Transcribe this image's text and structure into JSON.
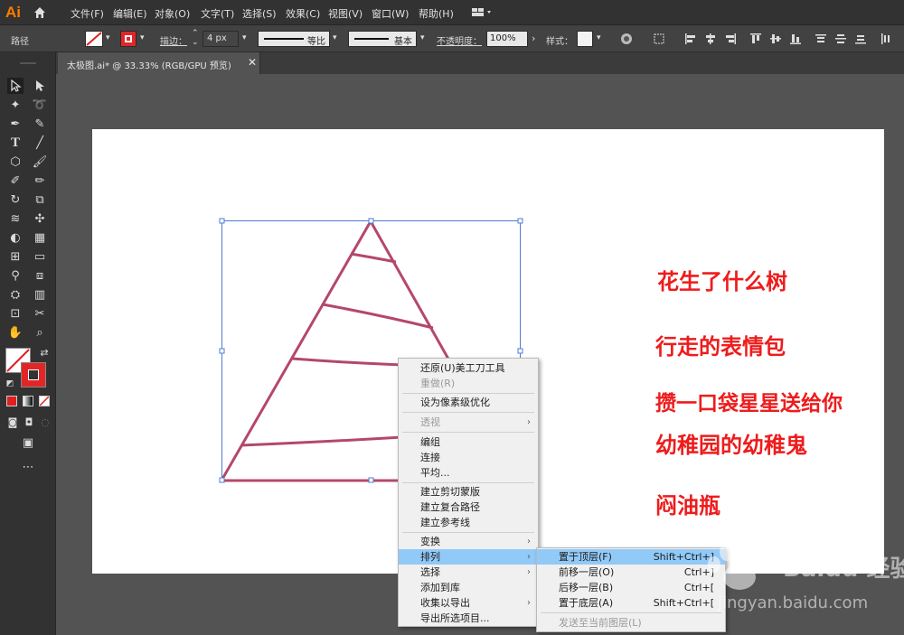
{
  "app": {
    "logo": "Ai",
    "menu": [
      "文件(F)",
      "编辑(E)",
      "对象(O)",
      "文字(T)",
      "选择(S)",
      "效果(C)",
      "视图(V)",
      "窗口(W)",
      "帮助(H)"
    ]
  },
  "control": {
    "selection_label": "路径",
    "stroke_label": "描边：",
    "stroke_weight": "4 px",
    "profile_label": "等比",
    "brush_label": "基本",
    "opacity_label": "不透明度：",
    "opacity_value": "100%",
    "style_label": "样式："
  },
  "document": {
    "tab_title": "太极图.ai* @ 33.33% (RGB/GPU 预览)",
    "close_glyph": "✕"
  },
  "colors": {
    "accent": "#ff7c00",
    "stroke_path": "#b5476b",
    "note_text": "#ee1c1c",
    "menu_highlight": "#91c9f7",
    "selection": "#4c7bd6"
  },
  "notes": [
    "花生了什么树",
    "行走的表情包",
    "攒一口袋星星送给你",
    "幼稚园的幼稚鬼",
    "闷油瓶"
  ],
  "context_menu": {
    "items": [
      {
        "label": "还原(U)美工刀工具",
        "disabled": false,
        "submenu": false
      },
      {
        "label": "重做(R)",
        "disabled": true,
        "submenu": false
      },
      {
        "label": "设为像素级优化",
        "disabled": false,
        "submenu": false
      },
      {
        "label": "透视",
        "disabled": true,
        "submenu": true
      },
      {
        "label": "编组",
        "disabled": false,
        "submenu": false
      },
      {
        "label": "连接",
        "disabled": false,
        "submenu": false
      },
      {
        "label": "平均...",
        "disabled": false,
        "submenu": false
      },
      {
        "label": "建立剪切蒙版",
        "disabled": false,
        "submenu": false
      },
      {
        "label": "建立复合路径",
        "disabled": false,
        "submenu": false
      },
      {
        "label": "建立参考线",
        "disabled": false,
        "submenu": false
      },
      {
        "label": "变换",
        "disabled": false,
        "submenu": true
      },
      {
        "label": "排列",
        "disabled": false,
        "submenu": true,
        "active": true
      },
      {
        "label": "选择",
        "disabled": false,
        "submenu": true
      },
      {
        "label": "添加到库",
        "disabled": false,
        "submenu": false
      },
      {
        "label": "收集以导出",
        "disabled": false,
        "submenu": true
      },
      {
        "label": "导出所选项目...",
        "disabled": false,
        "submenu": false
      }
    ],
    "submenu_glyph": "›"
  },
  "arrange_submenu": {
    "items": [
      {
        "label": "置于顶层(F)",
        "shortcut": "Shift+Ctrl+]",
        "active": true
      },
      {
        "label": "前移一层(O)",
        "shortcut": "Ctrl+]"
      },
      {
        "label": "后移一层(B)",
        "shortcut": "Ctrl+["
      },
      {
        "label": "置于底层(A)",
        "shortcut": "Shift+Ctrl+["
      },
      {
        "label": "发送至当前图层(L)",
        "shortcut": "",
        "disabled": true
      }
    ]
  },
  "watermark": {
    "brand": "Baidu 经验",
    "url": "jingyan.baidu.com"
  }
}
